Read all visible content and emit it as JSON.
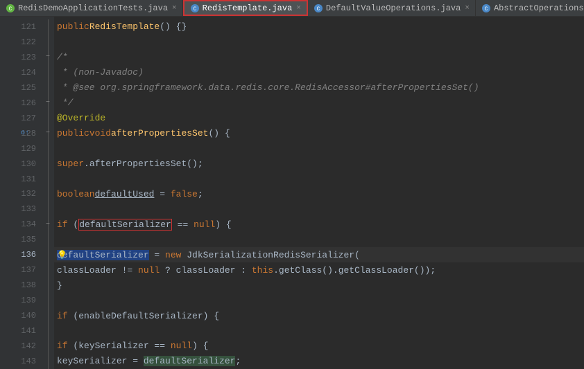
{
  "tabs": [
    {
      "label": "RedisDemoApplicationTests.java",
      "iconColor": "#62b543"
    },
    {
      "label": "RedisTemplate.java",
      "iconColor": "#4a88c7"
    },
    {
      "label": "DefaultValueOperations.java",
      "iconColor": "#4a88c7"
    },
    {
      "label": "AbstractOperations.java",
      "iconColor": "#4a88c7"
    }
  ],
  "lines": {
    "start": 121,
    "end": 143,
    "current": 136
  },
  "code": {
    "l121_public": "public",
    "l121_ctor": "RedisTemplate",
    "l121_rest": "() {}",
    "l123_cm": "/*",
    "l124_cm": " * (non-Javadoc)",
    "l125_cm": " * @see org.springframework.data.redis.core.RedisAccessor#afterPropertiesSet()",
    "l126_cm": " */",
    "l127_an": "@Override",
    "l128_public": "public",
    "l128_void": "void",
    "l128_fn": "afterPropertiesSet",
    "l128_rest": "() {",
    "l130_super": "super",
    "l130_call": ".afterPropertiesSet();",
    "l132_bool": "boolean",
    "l132_var": "defaultUsed",
    "l132_eq": " = ",
    "l132_false": "false",
    "l132_semi": ";",
    "l134_if": "if",
    "l134_open": " (",
    "l134_var": "defaultSerializer",
    "l134_rest": " == ",
    "l134_null": "null",
    "l134_close": ") {",
    "l136_var": "defaultSerializer",
    "l136_eq": " = ",
    "l136_new": "new",
    "l136_cls": " JdkSerializationRedisSerializer(",
    "l137_a": "classLoader != ",
    "l137_null": "null",
    "l137_b": " ? classLoader : ",
    "l137_this": "this",
    "l137_c": ".getClass().getClassLoader());",
    "l138_close": "}",
    "l140_if": "if",
    "l140_rest": " (enableDefaultSerializer) {",
    "l142_if": "if",
    "l142_rest": " (keySerializer == ",
    "l142_null": "null",
    "l142_close": ") {",
    "l143_a": "keySerializer = ",
    "l143_b": "defaultSerializer",
    "l143_c": ";"
  }
}
